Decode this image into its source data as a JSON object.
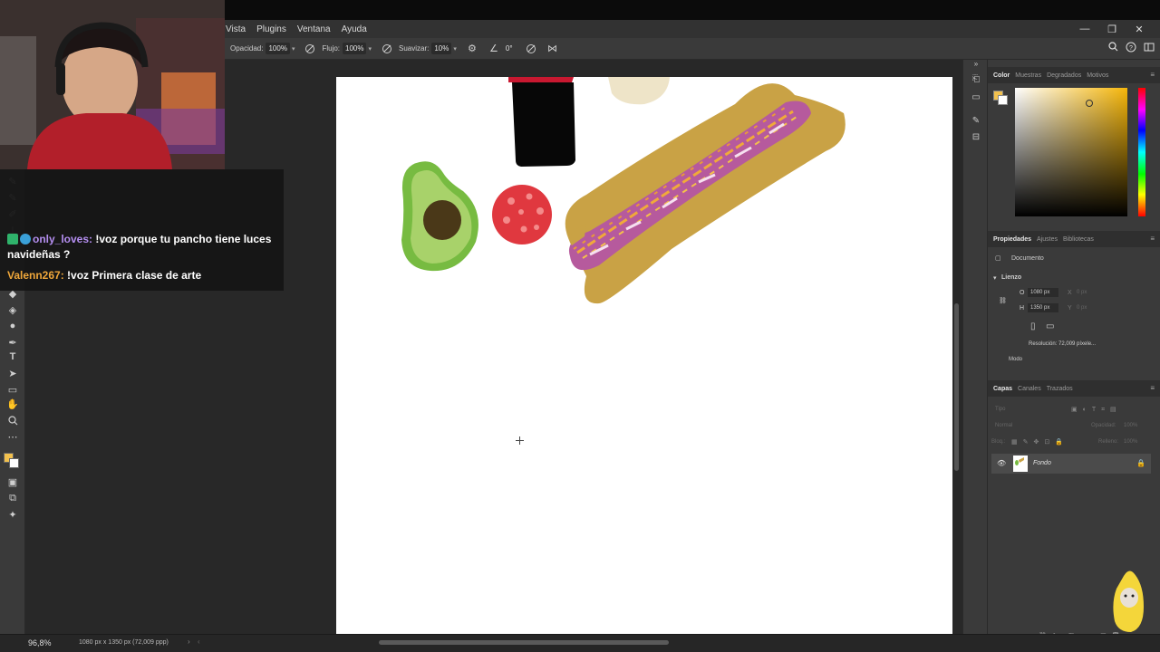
{
  "menu": [
    "Vista",
    "Plugins",
    "Ventana",
    "Ayuda"
  ],
  "window_controls": [
    "—",
    "❐",
    "✕"
  ],
  "options_bar": {
    "opacity_label": "Opacidad:",
    "opacity_value": "100%",
    "flow_label": "Flujo:",
    "flow_value": "100%",
    "smoothing_label": "Suavizar:",
    "smoothing_value": "10%",
    "angle_value": "0°"
  },
  "chat": {
    "messages": [
      {
        "user": "only_loves:",
        "text": " !voz porque tu pancho tiene luces navideñas ?"
      },
      {
        "user": "Valenn267:",
        "text": " !voz Primera clase de arte"
      }
    ]
  },
  "color_panel": {
    "tabs": [
      "Color",
      "Muestras",
      "Degradados",
      "Motivos"
    ],
    "foreground": "#f2c14e",
    "background": "#ffffff"
  },
  "properties_panel": {
    "tabs": [
      "Propiedades",
      "Ajustes",
      "Bibliotecas"
    ],
    "doc_label": "Documento",
    "section": "Lienzo",
    "w_label": "O",
    "w_value": "1080 px",
    "h_label": "H",
    "h_value": "1350 px",
    "x_label": "X",
    "x_value": "0 px",
    "y_label": "Y",
    "y_value": "0 px",
    "resolution": "Resolución: 72,009 píxele...",
    "mode": "Modo"
  },
  "layers_panel": {
    "tabs": [
      "Capas",
      "Canales",
      "Trazados"
    ],
    "search": "Tipo",
    "blend": "Normal",
    "opacity_label": "Opacidad:",
    "opacity_value": "100%",
    "lock_label": "Bloq.:",
    "fill_label": "Relleno:",
    "fill_value": "100%",
    "layers": [
      {
        "name": "Fondo",
        "locked": true,
        "visible": true
      }
    ]
  },
  "status": {
    "zoom": "96,8%",
    "doc_info": "1080 px x 1350 px (72,009 ppp)"
  }
}
